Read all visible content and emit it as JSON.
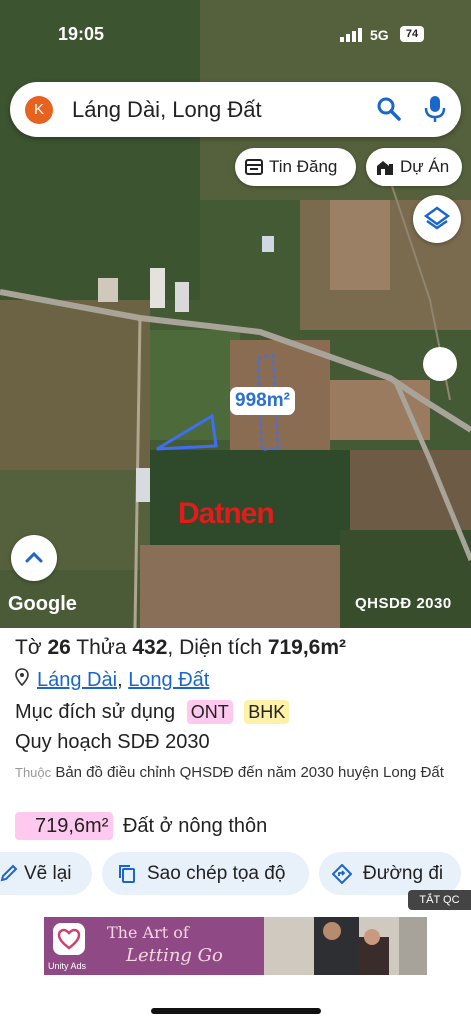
{
  "status": {
    "time": "19:05",
    "network": "5G",
    "battery": "74"
  },
  "search": {
    "avatar_letter": "K",
    "query": "Láng Dài, Long Đất"
  },
  "chips": {
    "tin_dang": "Tin Đăng",
    "du_an": "Dự Án"
  },
  "map": {
    "area_label": "998m²",
    "watermark": "Datnen",
    "google": "Google",
    "plan_code": "QHSDĐ 2030"
  },
  "info": {
    "title_prefix": "Tờ",
    "sheet": "26",
    "parcel_label": "Thửa",
    "parcel": "432",
    "area_prefix": "Diện tích",
    "area": "719,6m²",
    "commune": "Láng Dài",
    "district": "Long Đất",
    "purpose_label": "Mục đích sử dụng",
    "tag_ont": "ONT",
    "tag_bhk": "BHK",
    "plan_label": "Quy hoạch SDĐ 2030",
    "note_prefix": "Thuộc",
    "note": "Bản đồ điều chỉnh QHSDĐ đến năm 2030 huyện Long Đất",
    "area_badge": "719,6m²",
    "land_type": "Đất ở nông thôn"
  },
  "actions": {
    "ve_lai": "Vẽ lại",
    "sao_chep": "Sao chép tọa độ",
    "duong_di": "Đường đi"
  },
  "ad": {
    "tat_qc": "TẮT QC",
    "line1": "The Art of",
    "line2": "Letting Go",
    "unity": "Unity Ads"
  },
  "colors": {
    "accent": "#1b66c9",
    "pink_tag": "#ffc8ee",
    "yellow_tag": "#fff2a8",
    "button_bg": "#e8f0fa"
  }
}
